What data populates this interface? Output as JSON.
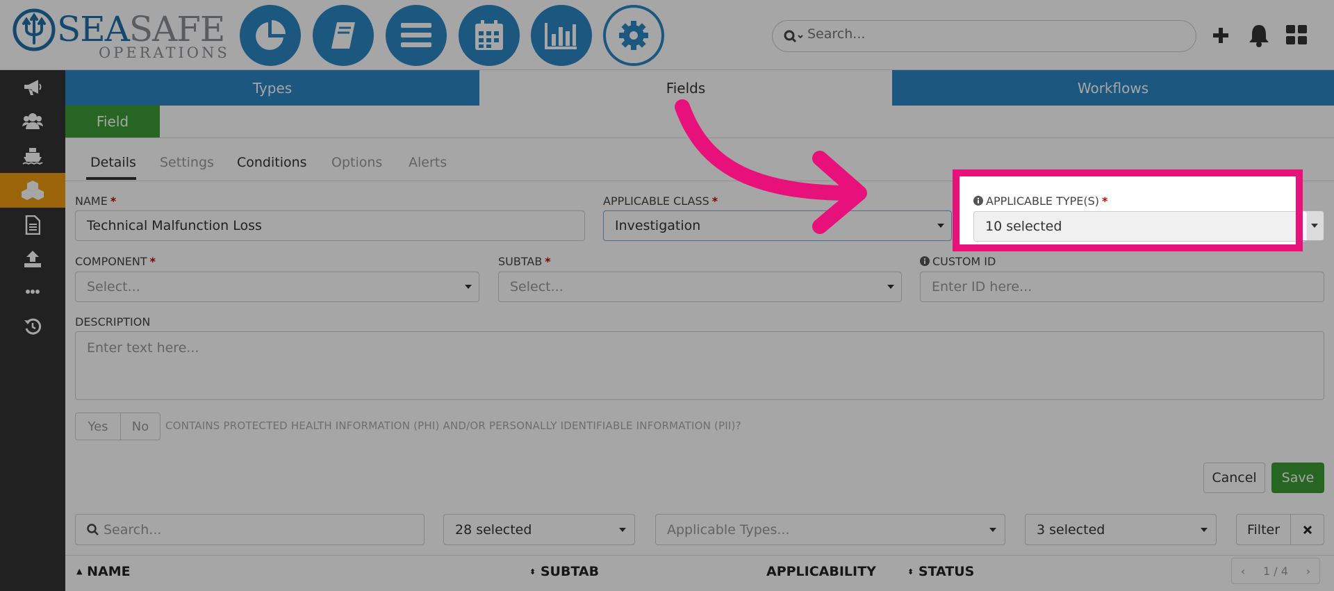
{
  "brand": {
    "name_a": "SEA",
    "name_b": "SAFE",
    "sub": "OPERATIONS"
  },
  "header": {
    "search_placeholder": "Search...",
    "nav_icons": [
      "pie-chart-icon",
      "book-icon",
      "list-icon",
      "calendar-icon",
      "bar-chart-icon",
      "gear-icon"
    ]
  },
  "sidebar": {
    "icons": [
      "megaphone-icon",
      "users-icon",
      "ship-icon",
      "cubes-icon",
      "document-icon",
      "upload-icon",
      "ellipsis-icon",
      "history-icon"
    ]
  },
  "tabs": [
    "Types",
    "Fields",
    "Workflows"
  ],
  "field_button": "Field",
  "subtabs": [
    "Details",
    "Settings",
    "Conditions",
    "Options",
    "Alerts"
  ],
  "form": {
    "name_label": "NAME",
    "name_value": "Technical Malfunction Loss",
    "class_label": "APPLICABLE CLASS",
    "class_value": "Investigation",
    "types_label": "APPLICABLE TYPE(S)",
    "types_value": "10 selected",
    "component_label": "COMPONENT",
    "component_placeholder": "Select...",
    "subtab_label": "SUBTAB",
    "subtab_placeholder": "Select...",
    "custom_id_label": "CUSTOM ID",
    "custom_id_placeholder": "Enter ID here...",
    "description_label": "DESCRIPTION",
    "description_placeholder": "Enter text here...",
    "phi_yes": "Yes",
    "phi_no": "No",
    "phi_label": "CONTAINS PROTECTED HEALTH INFORMATION (PHI) AND/OR PERSONALLY IDENTIFIABLE INFORMATION (PII)?",
    "required_mark": "*"
  },
  "actions": {
    "cancel": "Cancel",
    "save": "Save"
  },
  "filters": {
    "search_placeholder": "Search...",
    "sel1": "28 selected",
    "types_placeholder": "Applicable Types...",
    "sel3": "3 selected",
    "filter": "Filter"
  },
  "table": {
    "headers": [
      "NAME",
      "SUBTAB",
      "APPLICABILITY",
      "STATUS"
    ],
    "page": "1 / 4"
  },
  "colors": {
    "primary": "#2b86c5",
    "green": "#3c9b35",
    "orange": "#ef9b12",
    "highlight": "#e8107a"
  }
}
